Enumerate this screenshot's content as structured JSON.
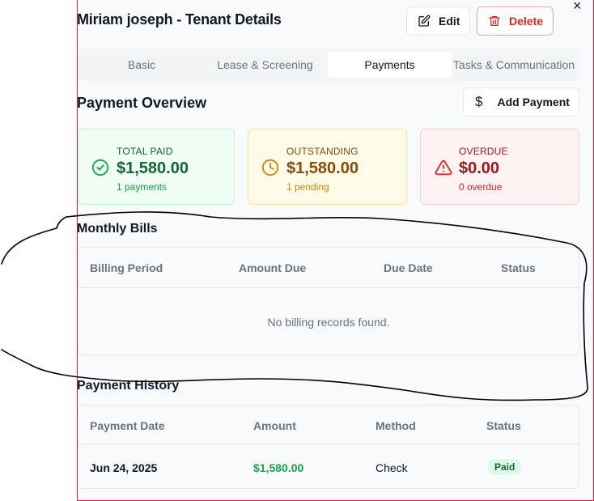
{
  "header": {
    "title": "Miriam joseph - Tenant Details",
    "edit_label": "Edit",
    "delete_label": "Delete",
    "close_glyph": "×"
  },
  "tabs": [
    {
      "label": "Basic"
    },
    {
      "label": "Lease & Screening"
    },
    {
      "label": "Payments",
      "active": true
    },
    {
      "label": "Tasks & Communication"
    }
  ],
  "overview": {
    "title": "Payment Overview",
    "add_label": "Add Payment",
    "add_icon": "$",
    "cards": {
      "total": {
        "label": "TOTAL PAID",
        "value": "$1,580.00",
        "sub": "1 payments"
      },
      "outstanding": {
        "label": "OUTSTANDING",
        "value": "$1,580.00",
        "sub": "1 pending"
      },
      "overdue": {
        "label": "OVERDUE",
        "value": "$0.00",
        "sub": "0 overdue"
      }
    }
  },
  "bills": {
    "title": "Monthly Bills",
    "columns": [
      "Billing Period",
      "Amount Due",
      "Due Date",
      "Status"
    ],
    "empty_message": "No billing records found."
  },
  "history": {
    "title": "Payment History",
    "columns": [
      "Payment Date",
      "Amount",
      "Method",
      "Status"
    ],
    "rows": [
      {
        "date": "Jun 24, 2025",
        "amount": "$1,580.00",
        "method": "Check",
        "status": "Paid"
      }
    ]
  },
  "colors": {
    "accent_red": "#dc2626",
    "accent_green": "#16a34a",
    "accent_yellow": "#ca8a04"
  }
}
